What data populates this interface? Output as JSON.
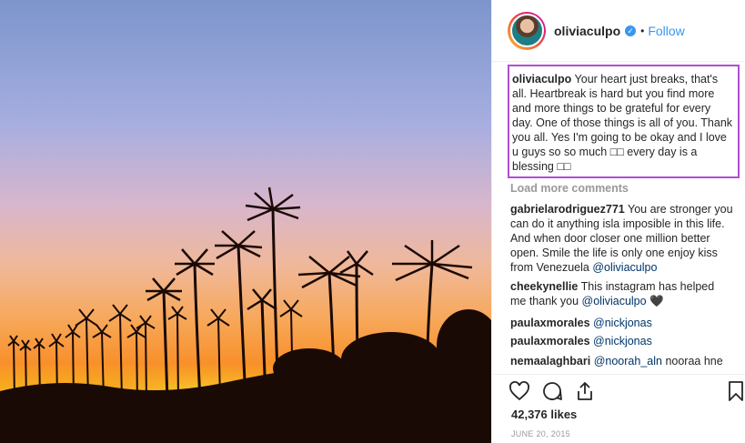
{
  "post": {
    "image_alt_icon": "sunset-palm-trees-photo",
    "header": {
      "username": "oliviaculpo",
      "verified_icon": "verified-badge-icon",
      "separator": "•",
      "follow_label": "Follow"
    },
    "caption": {
      "username": "oliviaculpo",
      "text": "Your heart just breaks, that's all. Heartbreak is hard but you find more and more things to be grateful for every day. One of those things is all of you. Thank you all. Yes I'm going to be okay and I love u guys so so much □□ every day is a blessing □□"
    },
    "load_more_label": "Load more comments",
    "comments": [
      {
        "username": "gabrielarodriguez771",
        "text": "You are stronger you can do it anything isla imposible in this life. And when door closer one million better open. Smile the life is only one enjoy kiss from Venezuela",
        "mention": "@oliviaculpo"
      },
      {
        "username": "cheekynellie",
        "text": "This instagram has helped me thank you",
        "mention": "@oliviaculpo",
        "suffix": "🖤"
      },
      {
        "username": "paulaxmorales",
        "text": "",
        "mention": "@nickjonas"
      },
      {
        "username": "paulaxmorales",
        "text": "",
        "mention": "@nickjonas"
      },
      {
        "username": "nemaalaghbari",
        "text": "",
        "mention": "@noorah_aln",
        "suffix": "nooraa hne"
      }
    ],
    "actions": {
      "like_icon": "heart-icon",
      "comment_icon": "comment-bubble-icon",
      "share_icon": "share-icon",
      "save_icon": "bookmark-icon"
    },
    "likes_label": "42,376 likes",
    "date_label": "JUNE 20, 2015"
  }
}
